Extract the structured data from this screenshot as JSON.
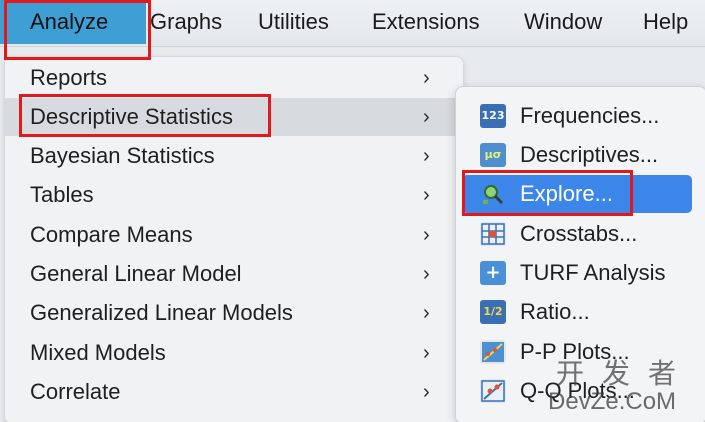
{
  "menubar": {
    "items": [
      "Analyze",
      "Graphs",
      "Utilities",
      "Extensions",
      "Window",
      "Help"
    ]
  },
  "main_menu": {
    "items": [
      {
        "label": "Reports"
      },
      {
        "label": "Descriptive Statistics"
      },
      {
        "label": "Bayesian Statistics"
      },
      {
        "label": "Tables"
      },
      {
        "label": "Compare Means"
      },
      {
        "label": "General Linear Model"
      },
      {
        "label": "Generalized Linear Models"
      },
      {
        "label": "Mixed Models"
      },
      {
        "label": "Correlate"
      }
    ],
    "chevron": "›"
  },
  "sub_menu": {
    "items": [
      {
        "label": "Frequencies...",
        "icon": "frequencies-icon",
        "icon_text": "123"
      },
      {
        "label": "Descriptives...",
        "icon": "descriptives-icon",
        "icon_text": "μσ"
      },
      {
        "label": "Explore...",
        "icon": "explore-icon",
        "icon_text": ""
      },
      {
        "label": "Crosstabs...",
        "icon": "crosstabs-icon",
        "icon_text": ""
      },
      {
        "label": "TURF Analysis",
        "icon": "turf-icon",
        "icon_text": "+"
      },
      {
        "label": "Ratio...",
        "icon": "ratio-icon",
        "icon_text": "1/2"
      },
      {
        "label": "P-P Plots...",
        "icon": "pp-plots-icon",
        "icon_text": ""
      },
      {
        "label": "Q-Q Plots...",
        "icon": "qq-plots-icon",
        "icon_text": ""
      }
    ]
  },
  "watermark": {
    "cn": "开发者",
    "en": "DevZe.CoM"
  },
  "colors": {
    "highlight_box": "#e2191c",
    "selection_blue": "#3b86e8",
    "menubar_active": "#3d9fd4"
  }
}
